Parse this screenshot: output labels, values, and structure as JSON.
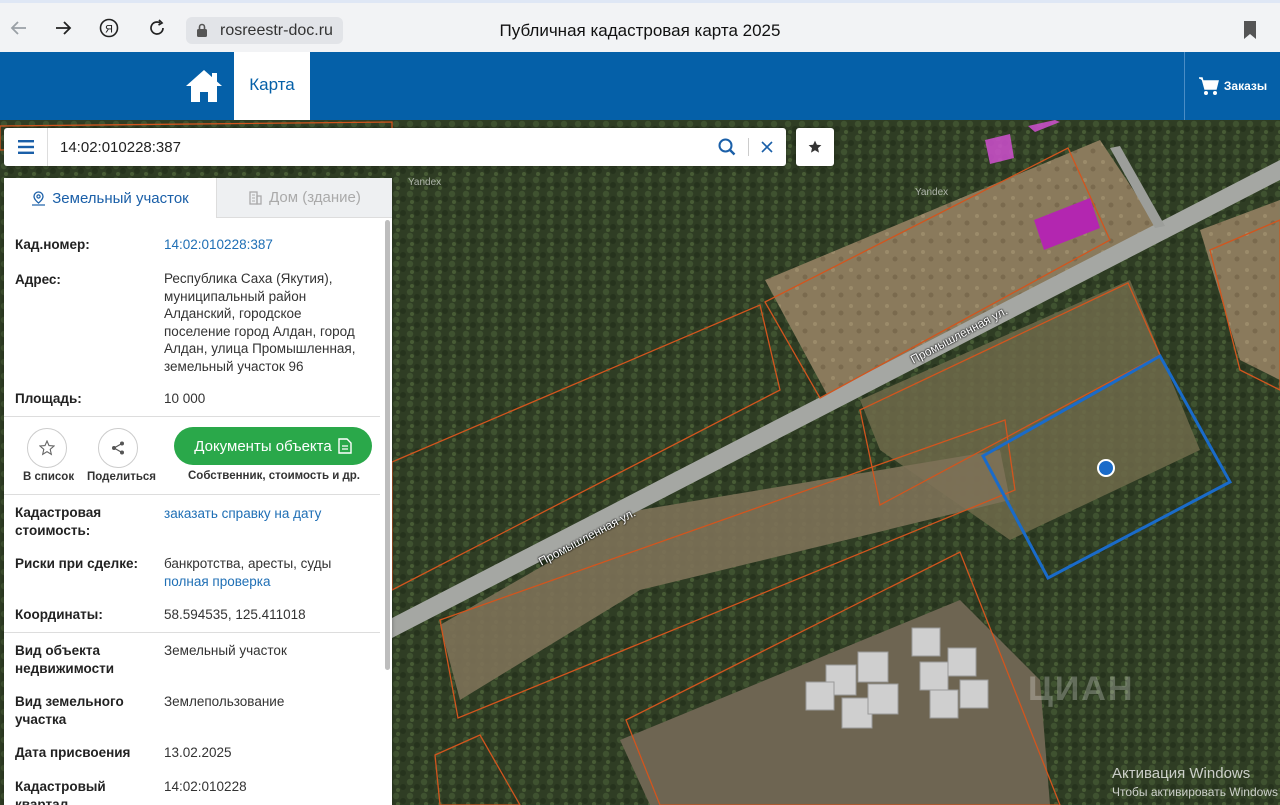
{
  "browser": {
    "url": "rosreestr-doc.ru",
    "page_title": "Публичная кадастровая карта 2025"
  },
  "header": {
    "map_tab": "Карта",
    "orders_label": "Заказы",
    "brand_color": "#0560a8"
  },
  "search": {
    "value": "14:02:010228:387"
  },
  "panel": {
    "tabs": [
      {
        "label": "Земельный участок",
        "icon": "map-pin-icon",
        "active": true
      },
      {
        "label": "Дом (здание)",
        "icon": "building-icon",
        "active": false
      }
    ],
    "cad_number": {
      "label": "Кад.номер:",
      "value": "14:02:010228:387"
    },
    "address": {
      "label": "Адрес:",
      "lines": [
        "Республика Саха (Якутия),",
        "муниципальный район",
        "Алданский, городское",
        "поселение город Алдан, город",
        "Алдан, улица Промышленная,",
        "земельный участок 96"
      ]
    },
    "area": {
      "label": "Площадь:",
      "value": "10 000"
    },
    "actions": {
      "add_to_list": "В список",
      "share": "Поделиться",
      "documents": "Документы объекта",
      "documents_sub": "Собственник, стоимость и др.",
      "documents_color": "#2aa84a"
    },
    "cad_value": {
      "label_line1": "Кадастровая",
      "label_line2": "стоимость:",
      "link": "заказать справку на дату"
    },
    "risks": {
      "label": "Риски при сделке:",
      "value": "банкротства, аресты, суды",
      "link": "полная проверка"
    },
    "coords": {
      "label": "Координаты:",
      "value": "58.594535, 125.411018"
    },
    "object_type": {
      "label_line1": "Вид объекта",
      "label_line2": "недвижимости",
      "value": "Земельный участок"
    },
    "land_type": {
      "label_line1": "Вид земельного",
      "label_line2": "участка",
      "value": "Землепользование"
    },
    "date_assigned": {
      "label": "Дата присвоения",
      "value": "13.02.2025"
    },
    "quarter": {
      "label_line1": "Кадастровый",
      "label_line2": "квартал",
      "value": "14:02:010228"
    }
  },
  "map": {
    "street_name": "Промышленная ул.",
    "yandex": "Yandex",
    "parcel_outline_color": "#d2551e",
    "selected_outline_color": "#1a6bc9",
    "windows_notice": "Активация Windows",
    "windows_notice_sub": "Чтобы активировать Windows",
    "watermark": "ЦИАН"
  }
}
